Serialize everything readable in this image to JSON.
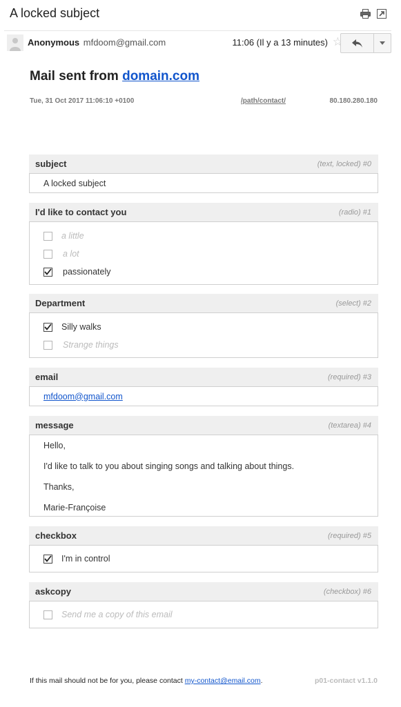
{
  "header": {
    "subject": "A locked subject"
  },
  "sender": {
    "name": "Anonymous",
    "email": "mfdoom@gmail.com",
    "time": "11:06 (Il y a 13 minutes)"
  },
  "mail": {
    "heading_prefix": "Mail sent from",
    "heading_domain": "domain.com",
    "date": "Tue, 31 Oct 2017 11:06:10 +0100",
    "path": "/path/contact/",
    "ip": "80.180.280.180"
  },
  "fields": {
    "subject": {
      "name": "subject",
      "type": "(text, locked) #0",
      "value": "A locked subject"
    },
    "contact": {
      "name": "I'd like to contact you",
      "type": "(radio) #1",
      "options": [
        "a little",
        "a lot",
        "passionately"
      ]
    },
    "department": {
      "name": "Department",
      "type": "(select) #2",
      "options": [
        "Silly walks",
        "Strange things"
      ]
    },
    "email": {
      "name": "email",
      "type": "(required) #3",
      "value": "mfdoom@gmail.com"
    },
    "message": {
      "name": "message",
      "type": "(textarea) #4",
      "lines": [
        "Hello,",
        "I'd like to talk to you about singing songs and talking about things.",
        "Thanks,",
        "Marie-Françoise"
      ]
    },
    "checkbox": {
      "name": "checkbox",
      "type": "(required) #5",
      "label": "I'm in control"
    },
    "askcopy": {
      "name": "askcopy",
      "type": "(checkbox) #6",
      "label": "Send me a copy of this email"
    }
  },
  "footer": {
    "text": "If this mail should not be for you, please contact",
    "contact_email": "my-contact@email.com",
    "period": ".",
    "version": "p01-contact v1.1.0"
  },
  "colors": {
    "link": "#1155cc",
    "field_header_bg": "#efefef",
    "border": "#cfcfcf"
  }
}
